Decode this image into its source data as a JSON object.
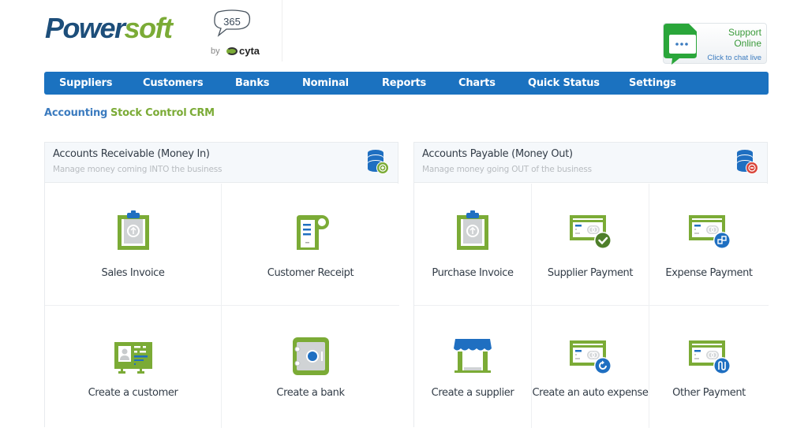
{
  "header": {
    "logo": {
      "part1": "Power",
      "part2": "soft",
      "badge": "365",
      "by": "by",
      "partner": "cyta"
    },
    "support": {
      "line1": "Support",
      "line2": "Online",
      "line3": "Click to chat live"
    }
  },
  "nav": {
    "items": [
      {
        "label": "Suppliers"
      },
      {
        "label": "Customers"
      },
      {
        "label": "Banks"
      },
      {
        "label": "Nominal"
      },
      {
        "label": "Reports"
      },
      {
        "label": "Charts"
      },
      {
        "label": "Quick Status"
      },
      {
        "label": "Settings"
      }
    ]
  },
  "subnav": {
    "items": [
      {
        "label": "Accounting",
        "color": "#3b7bbf",
        "active": true
      },
      {
        "label": "Stock Control",
        "color": "#7bab36",
        "active": false
      },
      {
        "label": "CRM",
        "color": "#7bab36",
        "active": false
      }
    ]
  },
  "receivable": {
    "title": "Accounts Receivable (Money In)",
    "subtitle": "Manage money coming INTO the business",
    "icon": "database-add-icon",
    "tiles": [
      {
        "label": "Sales Invoice",
        "icon": "clipboard-invoice-icon"
      },
      {
        "label": "Customer Receipt",
        "icon": "receipt-icon"
      },
      {
        "label": "Create a customer",
        "icon": "id-card-icon"
      },
      {
        "label": "Create a bank",
        "icon": "safe-icon"
      }
    ]
  },
  "payable": {
    "title": "Accounts Payable (Money Out)",
    "subtitle": "Manage money going OUT of the business",
    "icon": "database-remove-icon",
    "tiles": [
      {
        "label": "Purchase Invoice",
        "icon": "clipboard-invoice-icon"
      },
      {
        "label": "Supplier Payment",
        "icon": "card-check-icon"
      },
      {
        "label": "Expense Payment",
        "icon": "card-exchange-icon"
      },
      {
        "label": "Create a supplier",
        "icon": "storefront-icon"
      },
      {
        "label": "Create an auto expense",
        "icon": "card-refresh-icon"
      },
      {
        "label": "Other Payment",
        "icon": "card-transfer-icon"
      }
    ]
  },
  "colors": {
    "nav_bg": "#1b72c0",
    "brand_green": "#7bab36",
    "brand_blue": "#1d4e7a",
    "icon_blue": "#1f6fc1",
    "danger": "#d9453a"
  }
}
